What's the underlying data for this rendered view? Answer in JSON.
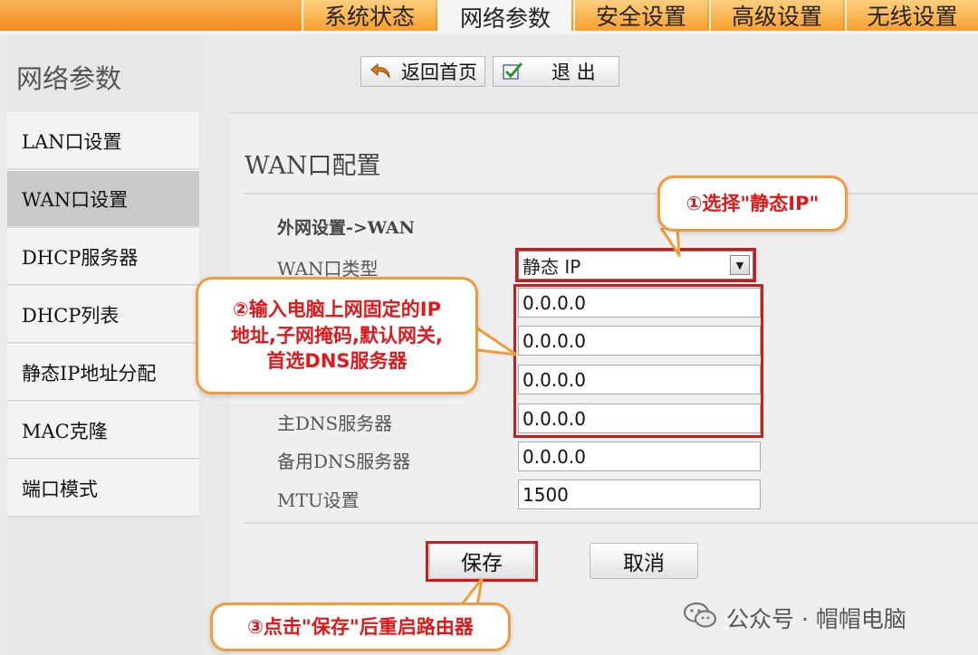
{
  "tabs": [
    {
      "label": "系统状态",
      "active": false
    },
    {
      "label": "网络参数",
      "active": true
    },
    {
      "label": "安全设置",
      "active": false
    },
    {
      "label": "高级设置",
      "active": false
    },
    {
      "label": "无线设置",
      "active": false
    }
  ],
  "section_title": "网络参数",
  "nav": {
    "home_label": "返回首页",
    "exit_label": "退 出"
  },
  "sidebar": {
    "items": [
      {
        "label": "LAN口设置",
        "active": false
      },
      {
        "label": "WAN口设置",
        "active": true
      },
      {
        "label": "DHCP服务器",
        "active": false
      },
      {
        "label": "DHCP列表",
        "active": false
      },
      {
        "label": "静态IP地址分配",
        "active": false
      },
      {
        "label": "MAC克隆",
        "active": false
      },
      {
        "label": "端口模式",
        "active": false
      }
    ]
  },
  "main": {
    "title": "WAN口配置",
    "group_label": "外网设置->WAN",
    "wan_type_label": "WAN口类型",
    "wan_type_value": "静态 IP",
    "fields": {
      "ip": "0.0.0.0",
      "mask": "0.0.0.0",
      "gateway": "0.0.0.0",
      "primary_dns_label": "主DNS服务器",
      "primary_dns": "0.0.0.0",
      "secondary_dns_label": "备用DNS服务器",
      "secondary_dns": "0.0.0.0",
      "mtu_label": "MTU设置",
      "mtu": "1500"
    },
    "save_label": "保存",
    "cancel_label": "取消"
  },
  "callouts": {
    "step1": "①选择\"静态IP\"",
    "step2_line1": "②输入电脑上网固定的IP",
    "step2_line2": "地址,子网掩码,默认网关,",
    "step2_line3": "首选DNS服务器",
    "step3": "③点击\"保存\"后重启路由器"
  },
  "watermark": "公众号 · 帽帽电脑",
  "colors": {
    "tab_orange": "#f39a2e",
    "highlight_red": "#c81d1d",
    "callout_border": "#f39a3a",
    "callout_text": "#e0181b"
  }
}
